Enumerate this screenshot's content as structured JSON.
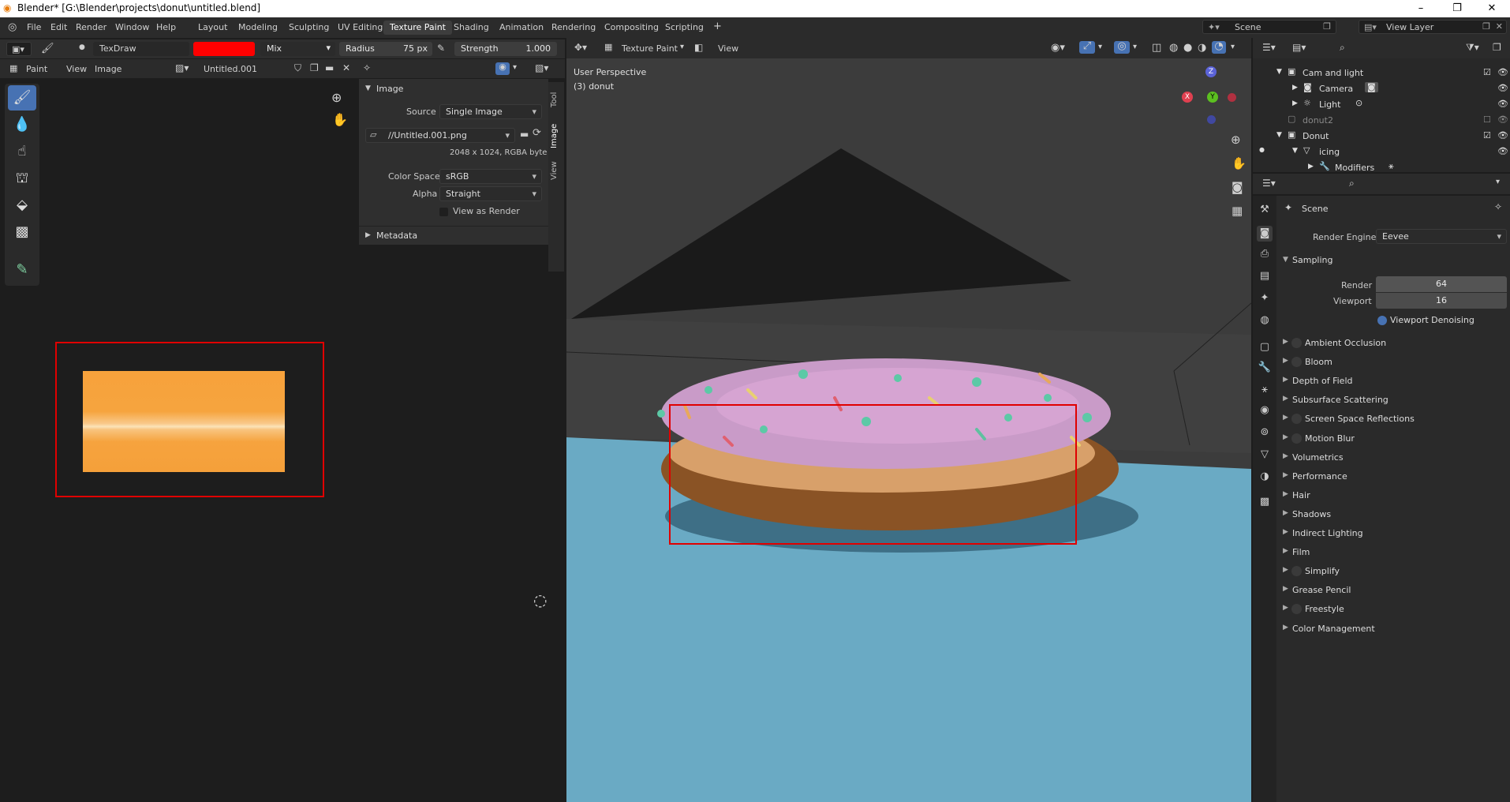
{
  "window": {
    "title": "Blender* [G:\\Blender\\projects\\donut\\untitled.blend]"
  },
  "menus": [
    "File",
    "Edit",
    "Render",
    "Window",
    "Help"
  ],
  "workspaces": [
    "Layout",
    "Modeling",
    "Sculpting",
    "UV Editing",
    "Texture Paint",
    "Shading",
    "Animation",
    "Rendering",
    "Compositing",
    "Scripting",
    "+"
  ],
  "scene": {
    "label": "Scene",
    "view_layer": "View Layer"
  },
  "image_editor": {
    "header": {
      "brush": "TexDraw",
      "blend": "Mix",
      "radius_label": "Radius",
      "radius_value": "75 px",
      "strength_label": "Strength",
      "strength_value": "1.000"
    },
    "header2": {
      "mode": "Paint",
      "view": "View",
      "image": "Image",
      "image_name": "Untitled.001"
    },
    "panel": {
      "title": "Image",
      "source_label": "Source",
      "source_value": "Single Image",
      "filepath": "//Untitled.001.png",
      "info": "2048 x 1024,  RGBA byte",
      "colorspace_label": "Color Space",
      "colorspace_value": "sRGB",
      "alpha_label": "Alpha",
      "alpha_value": "Straight",
      "view_as_render": "View as Render",
      "metadata": "Metadata"
    },
    "tabs": [
      "Tool",
      "Image",
      "View"
    ]
  },
  "viewport": {
    "header_mode": "Texture Paint",
    "header_view": "View",
    "perspective": "User Perspective",
    "object": "(3) donut",
    "axes": {
      "x": "X",
      "y": "Y",
      "z": "Z"
    }
  },
  "outliner": {
    "items": [
      {
        "label": "Cam and light",
        "indent": 0
      },
      {
        "label": "Camera",
        "indent": 1
      },
      {
        "label": "Light",
        "indent": 1
      },
      {
        "label": "donut2",
        "indent": 0
      },
      {
        "label": "Donut",
        "indent": 0
      },
      {
        "label": "icing",
        "indent": 1
      },
      {
        "label": "Modifiers",
        "indent": 2
      }
    ]
  },
  "properties": {
    "scene": "Scene",
    "render_engine_label": "Render Engine",
    "render_engine_value": "Eevee",
    "sampling": {
      "title": "Sampling",
      "render_label": "Render",
      "render_value": "64",
      "viewport_label": "Viewport",
      "viewport_value": "16",
      "denoise": "Viewport Denoising"
    },
    "sections": [
      {
        "label": "Ambient Occlusion",
        "checkbox": true
      },
      {
        "label": "Bloom",
        "checkbox": true
      },
      {
        "label": "Depth of Field",
        "checkbox": false
      },
      {
        "label": "Subsurface Scattering",
        "checkbox": false
      },
      {
        "label": "Screen Space Reflections",
        "checkbox": true
      },
      {
        "label": "Motion Blur",
        "checkbox": true
      },
      {
        "label": "Volumetrics",
        "checkbox": false
      },
      {
        "label": "Performance",
        "checkbox": false
      },
      {
        "label": "Hair",
        "checkbox": false
      },
      {
        "label": "Shadows",
        "checkbox": false
      },
      {
        "label": "Indirect Lighting",
        "checkbox": false
      },
      {
        "label": "Film",
        "checkbox": false
      },
      {
        "label": "Simplify",
        "checkbox": true
      },
      {
        "label": "Grease Pencil",
        "checkbox": false
      },
      {
        "label": "Freestyle",
        "checkbox": true
      },
      {
        "label": "Color Management",
        "checkbox": false
      }
    ]
  },
  "colors": {
    "accent": "#4772b3",
    "brush_color": "#ff0000",
    "annotation": "#e00000"
  }
}
